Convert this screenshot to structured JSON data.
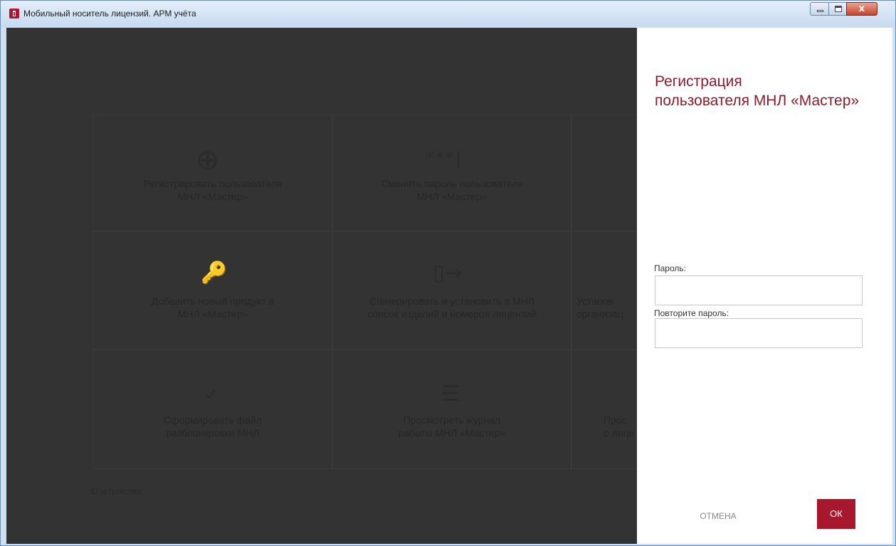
{
  "window": {
    "title": "Мобильный носитель лицензий. АРМ учёта",
    "close_glyph": "x"
  },
  "tiles": [
    {
      "icon": "⊕",
      "label": "Регистрировать пользователя\nМНЛ «Мастер»"
    },
    {
      "icon": "***|",
      "label": "Сменить пароль пользователя\nМНЛ «Мастер»"
    },
    {
      "icon": "🔑",
      "label": "Добавить новый продукт в\nМНЛ «Мастер»"
    },
    {
      "icon": "▯→",
      "label": "Сгенерировать и установить в МНЛ\nсписок изделий и номеров лицензий"
    },
    {
      "icon": "",
      "label": "Установ\nорганизац"
    },
    {
      "icon": "✓",
      "label": "Сформировать файл\nразблокировки МНЛ"
    },
    {
      "icon": "☰",
      "label": "Просмотреть журнал\nработы МНЛ «Мастер»"
    },
    {
      "icon": "",
      "label": "Прос\nо лице"
    }
  ],
  "device_id_label": "ID устройства:",
  "panel": {
    "title": "Регистрация\nпользователя МНЛ «Мастер»",
    "password_label": "Пароль:",
    "password_value": "",
    "repeat_label": "Повторите пароль:",
    "repeat_value": "",
    "cancel_label": "ОТМЕНА",
    "ok_label": "ОК"
  },
  "colors": {
    "accent": "#a7182d",
    "overlay": "#333333",
    "title": "#8c1a2a"
  }
}
